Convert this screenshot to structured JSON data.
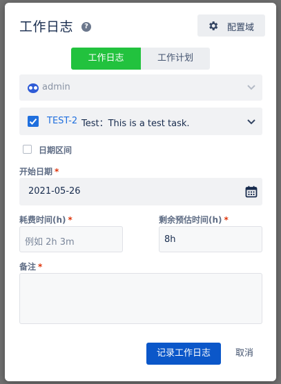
{
  "dialog": {
    "title": "工作日志",
    "help_icon": "?",
    "config_button": {
      "label": "配置域",
      "icon": "gear-icon"
    }
  },
  "tabs": [
    {
      "label": "工作日志",
      "active": true
    },
    {
      "label": "工作计划",
      "active": false
    }
  ],
  "user_select": {
    "value": "admin",
    "icon": "avatar-icon"
  },
  "issue_select": {
    "key": "TEST-2",
    "summary": "Test：This is a test task.",
    "checked": true
  },
  "date_range": {
    "label": "日期区间",
    "checked": false
  },
  "start_date": {
    "label": "开始日期",
    "required_mark": "*",
    "value": "2021-05-26"
  },
  "time_spent": {
    "label": "耗费时间(h)",
    "required_mark": "*",
    "placeholder": "例如 2h 3m",
    "value": ""
  },
  "remaining": {
    "label": "剩余预估时间(h)",
    "required_mark": "*",
    "value": "8h"
  },
  "notes": {
    "label": "备注",
    "required_mark": "*",
    "value": ""
  },
  "actions": {
    "submit_label": "记录工作日志",
    "cancel_label": "取消"
  },
  "colors": {
    "tab_active": "#22c23e",
    "primary": "#0b57c9",
    "link": "#1f6fde",
    "required": "#de350b"
  }
}
